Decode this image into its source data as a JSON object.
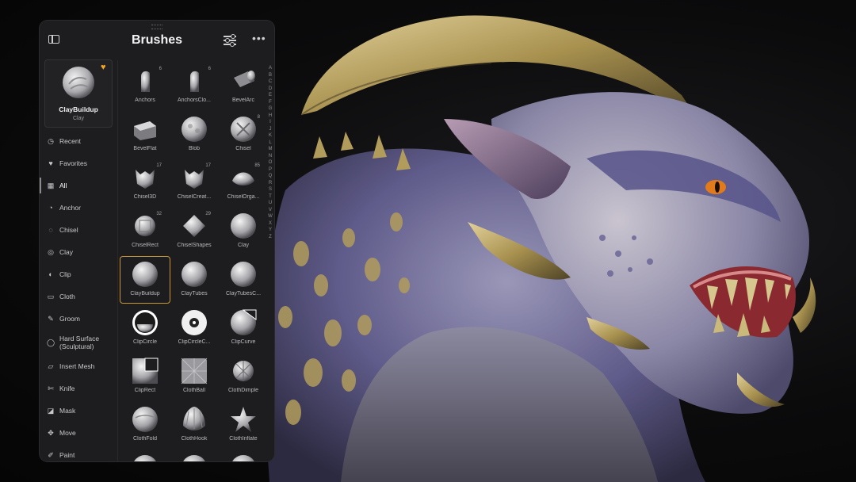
{
  "panel": {
    "title": "Brushes",
    "current_brush": {
      "name": "ClayBuildup",
      "category": "Clay"
    },
    "categories": [
      {
        "label": "Recent",
        "icon": "clock-icon"
      },
      {
        "label": "Favorites",
        "icon": "heart-icon"
      },
      {
        "label": "All",
        "icon": "grid-icon",
        "active": true
      },
      {
        "label": "Anchor",
        "icon": "anchor-icon"
      },
      {
        "label": "Chisel",
        "icon": "chisel-icon"
      },
      {
        "label": "Clay",
        "icon": "clay-icon"
      },
      {
        "label": "Clip",
        "icon": "clip-icon"
      },
      {
        "label": "Cloth",
        "icon": "cloth-icon"
      },
      {
        "label": "Groom",
        "icon": "groom-icon"
      },
      {
        "label": "Hard Surface (Sculptural)",
        "icon": "hard-surface-icon"
      },
      {
        "label": "Insert Mesh",
        "icon": "insert-mesh-icon"
      },
      {
        "label": "Knife",
        "icon": "knife-icon"
      },
      {
        "label": "Mask",
        "icon": "mask-icon"
      },
      {
        "label": "Move",
        "icon": "move-icon"
      },
      {
        "label": "Paint",
        "icon": "paint-icon"
      }
    ],
    "brushes": [
      {
        "label": "Anchors",
        "count": "6",
        "shape": "anchor"
      },
      {
        "label": "AnchorsClo...",
        "count": "6",
        "shape": "anchor"
      },
      {
        "label": "BevelArc",
        "count": "",
        "shape": "cylinder"
      },
      {
        "label": "BevelFlat",
        "count": "",
        "shape": "block"
      },
      {
        "label": "Blob",
        "count": "",
        "shape": "blob"
      },
      {
        "label": "Chisel",
        "count": "8",
        "shape": "chisel"
      },
      {
        "label": "Chisel3D",
        "count": "17",
        "shape": "creature"
      },
      {
        "label": "ChiselCreat...",
        "count": "17",
        "shape": "creature"
      },
      {
        "label": "ChiselOrga...",
        "count": "85",
        "shape": "organic"
      },
      {
        "label": "ChiselRect",
        "count": "32",
        "shape": "rect-ball"
      },
      {
        "label": "ChiselShapes",
        "count": "29",
        "shape": "shapes"
      },
      {
        "label": "Clay",
        "count": "",
        "shape": "sphere"
      },
      {
        "label": "ClayBuildup",
        "count": "",
        "shape": "sphere",
        "selected": true
      },
      {
        "label": "ClayTubes",
        "count": "",
        "shape": "sphere"
      },
      {
        "label": "ClayTubesC...",
        "count": "",
        "shape": "sphere"
      },
      {
        "label": "ClipCircle",
        "count": "",
        "shape": "clip-circle"
      },
      {
        "label": "ClipCircleC...",
        "count": "",
        "shape": "clip-circle-c"
      },
      {
        "label": "ClipCurve",
        "count": "",
        "shape": "clip-curve"
      },
      {
        "label": "ClipRect",
        "count": "",
        "shape": "clip-rect"
      },
      {
        "label": "ClothBall",
        "count": "",
        "shape": "cloth-ball"
      },
      {
        "label": "ClothDimple",
        "count": "",
        "shape": "dimple"
      },
      {
        "label": "ClothFold",
        "count": "",
        "shape": "fold"
      },
      {
        "label": "ClothHook",
        "count": "",
        "shape": "shell"
      },
      {
        "label": "ClothInflate",
        "count": "",
        "shape": "inflate"
      },
      {
        "label": "",
        "count": "",
        "shape": "sphere"
      },
      {
        "label": "",
        "count": "",
        "shape": "sphere"
      },
      {
        "label": "",
        "count": "",
        "shape": "sphere"
      }
    ],
    "alphabet": [
      "A",
      "B",
      "C",
      "D",
      "E",
      "F",
      "G",
      "H",
      "I",
      "J",
      "K",
      "L",
      "M",
      "N",
      "O",
      "P",
      "Q",
      "R",
      "S",
      "T",
      "U",
      "V",
      "W",
      "X",
      "Y",
      "Z"
    ]
  },
  "colors": {
    "accent": "#c9972f",
    "favorite": "#f2a526",
    "panel": "#1d1d1f",
    "skin": "#6e6a9c",
    "horn": "#b9a467",
    "eye": "#e07a1a"
  }
}
